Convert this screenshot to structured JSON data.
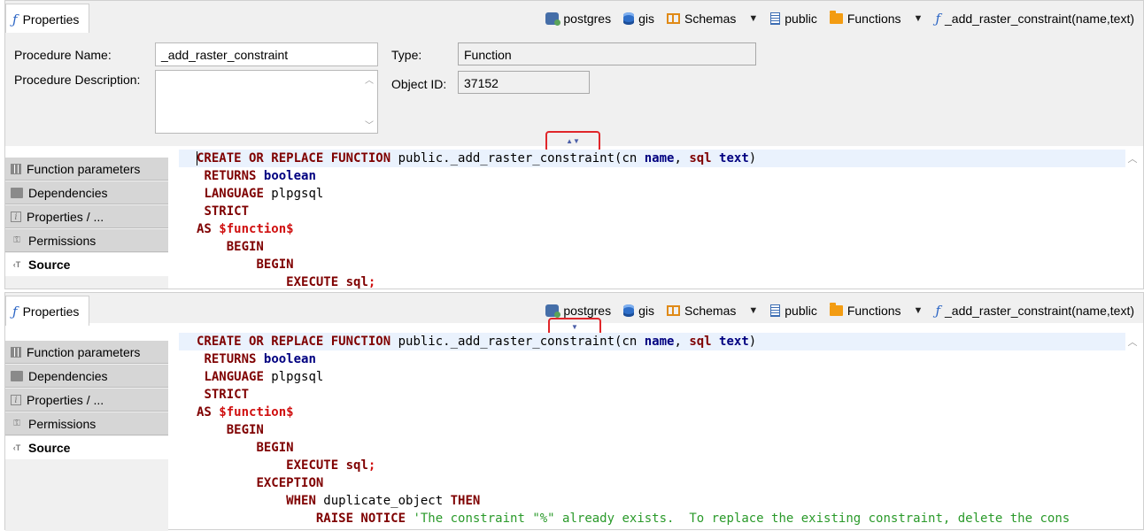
{
  "breadcrumb": {
    "items": [
      {
        "label": "postgres",
        "icon": "postgres-server-icon"
      },
      {
        "label": "gis",
        "icon": "database-icon"
      },
      {
        "label": "Schemas",
        "icon": "schemas-icon"
      },
      {
        "label": "public",
        "icon": "schema-icon"
      },
      {
        "label": "Functions",
        "icon": "folder-icon"
      },
      {
        "label": "_add_raster_constraint(name,text)",
        "icon": "function-icon"
      }
    ]
  },
  "top_panel": {
    "tab_label": "Properties",
    "form": {
      "procedure_name_label": "Procedure Name:",
      "procedure_name_value": "_add_raster_constraint",
      "procedure_description_label": "Procedure Description:",
      "procedure_description_value": "",
      "type_label": "Type:",
      "type_value": "Function",
      "object_id_label": "Object ID:",
      "object_id_value": "37152"
    },
    "toggle_label": "▲▼"
  },
  "bottom_panel": {
    "tab_label": "Properties",
    "toggle_label": "▼"
  },
  "nav": {
    "items": [
      {
        "label": "Function parameters",
        "icon": "table-icon"
      },
      {
        "label": "Dependencies",
        "icon": "folder-icon"
      },
      {
        "label": "Properties / ...",
        "icon": "info-icon"
      },
      {
        "label": "Permissions",
        "icon": "key-icon"
      },
      {
        "label": "Source",
        "icon": "source-icon",
        "active": true
      }
    ]
  },
  "code": {
    "lines": [
      [
        [
          "kw",
          "CREATE OR REPLACE FUNCTION"
        ],
        [
          "tx",
          " public._add_raster_constraint(cn "
        ],
        [
          "ty",
          "name"
        ],
        [
          "tx",
          ", "
        ],
        [
          "kw",
          "sql"
        ],
        [
          "tx",
          " "
        ],
        [
          "ty",
          "text"
        ],
        [
          "tx",
          ")"
        ]
      ],
      [
        [
          "tx",
          " "
        ],
        [
          "kw",
          "RETURNS"
        ],
        [
          "tx",
          " "
        ],
        [
          "ty",
          "boolean"
        ]
      ],
      [
        [
          "tx",
          " "
        ],
        [
          "kw",
          "LANGUAGE"
        ],
        [
          "tx",
          " plpgsql"
        ]
      ],
      [
        [
          "tx",
          " "
        ],
        [
          "kw",
          "STRICT"
        ]
      ],
      [
        [
          "kw",
          "AS"
        ],
        [
          "tx",
          " "
        ],
        [
          "dl",
          "$function$"
        ]
      ],
      [
        [
          "tx",
          "    "
        ],
        [
          "kw",
          "BEGIN"
        ]
      ],
      [
        [
          "tx",
          "        "
        ],
        [
          "kw",
          "BEGIN"
        ]
      ],
      [
        [
          "tx",
          "            "
        ],
        [
          "kw",
          "EXECUTE"
        ],
        [
          "tx",
          " "
        ],
        [
          "kw",
          "sql"
        ],
        [
          "dl",
          ";"
        ]
      ],
      [
        [
          "tx",
          "        "
        ],
        [
          "kw",
          "EXCEPTION"
        ]
      ],
      [
        [
          "tx",
          "            "
        ],
        [
          "kw",
          "WHEN"
        ],
        [
          "tx",
          " duplicate_object "
        ],
        [
          "kw",
          "THEN"
        ]
      ],
      [
        [
          "tx",
          "                "
        ],
        [
          "kw",
          "RAISE NOTICE"
        ],
        [
          "tx",
          " "
        ],
        [
          "st",
          "'The constraint \"%\" already exists.  To replace the existing constraint, delete the cons"
        ]
      ]
    ]
  },
  "colors": {
    "keyword": "#7f0000",
    "type": "#000080",
    "dollar_quote": "#d01010",
    "string": "#2a9a2a",
    "highlight_line": "#eaf2fd",
    "toggle_border": "#e0262a"
  }
}
